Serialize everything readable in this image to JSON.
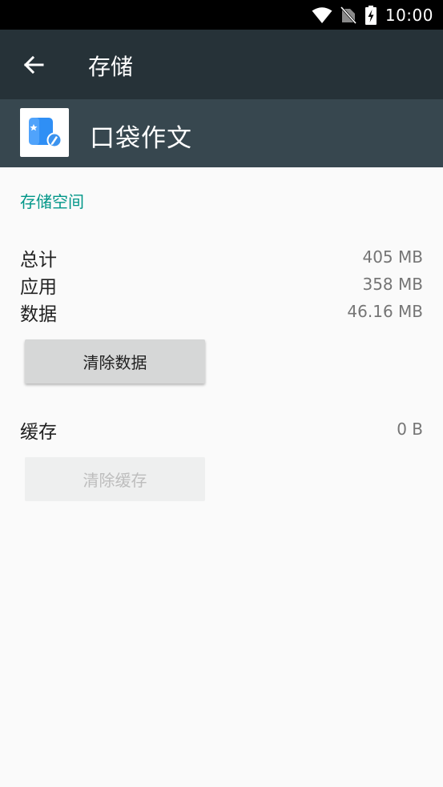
{
  "status_bar": {
    "time": "10:00"
  },
  "app_bar": {
    "title": "存储"
  },
  "app_header": {
    "name": "口袋作文"
  },
  "storage": {
    "section_title": "存储空间",
    "total_label": "总计",
    "total_value": "405 MB",
    "app_label": "应用",
    "app_value": "358 MB",
    "data_label": "数据",
    "data_value": "46.16 MB",
    "clear_data_label": "清除数据"
  },
  "cache": {
    "label": "缓存",
    "value": "0 B",
    "clear_cache_label": "清除缓存"
  },
  "colors": {
    "status_bar": "#000000",
    "app_bar": "#263238",
    "app_header": "#37474f",
    "accent": "#009688",
    "background": "#fafafa"
  }
}
